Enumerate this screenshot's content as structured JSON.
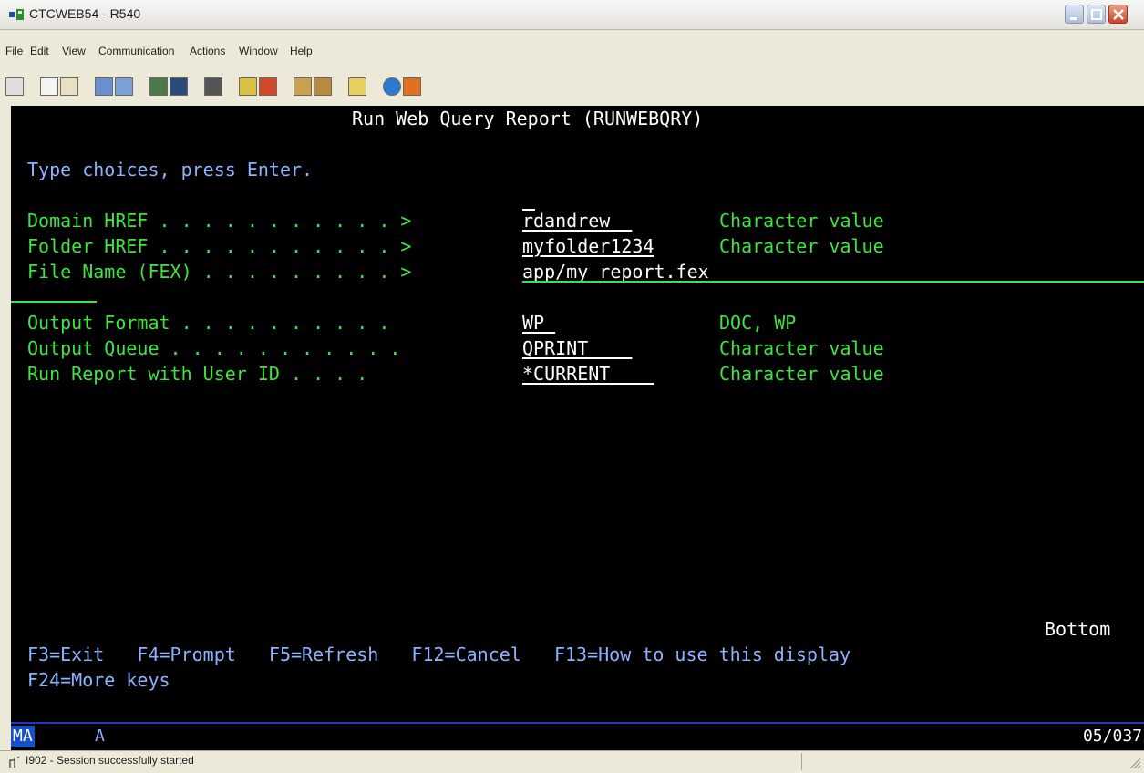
{
  "window": {
    "title": "CTCWEB54 - R540"
  },
  "menu": {
    "items": [
      "File",
      "Edit",
      "View",
      "Communication",
      "Actions",
      "Window",
      "Help"
    ]
  },
  "toolbar": {
    "icons": [
      "print-screen-icon",
      "copy-icon",
      "paste-icon",
      "send-icon",
      "receive-icon",
      "display-icon",
      "keypad-icon",
      "macro-icon",
      "record-icon",
      "play-icon",
      "transfer-icon",
      "receive-file-icon",
      "clipboard-icon",
      "globe-icon",
      "help-icon"
    ]
  },
  "screen": {
    "title": "Run Web Query Report (RUNWEBQRY)",
    "instruction": "Type choices, press Enter.",
    "params": [
      {
        "label": "Domain HREF . . . . . . . . . . . >",
        "value": "rdandrew  ",
        "hint": "Character value"
      },
      {
        "label": "Folder HREF . . . . . . . . . . . >",
        "value": "myfolder1234",
        "hint": "Character value"
      },
      {
        "label": "File Name (FEX) . . . . . . . . . >",
        "value": "app/my report.fex",
        "hint": ""
      },
      {
        "label": "Output Format . . . . . . . . . .  ",
        "value": "WP ",
        "hint": "DOC, WP"
      },
      {
        "label": "Output Queue . . . . . . . . . . . ",
        "value": "QPRINT    ",
        "hint": "Character value"
      },
      {
        "label": "Run Report with User ID . . . .    ",
        "value": "*CURRENT    ",
        "hint": "Character value"
      }
    ],
    "more_indicator": "Bottom",
    "fkeys_line1": "F3=Exit   F4=Prompt   F5=Refresh   F12=Cancel   F13=How to use this display",
    "fkeys_line2": "F24=More keys"
  },
  "oia": {
    "mode": "MA",
    "indicator": "A",
    "cursor_pos": "05/037"
  },
  "status": {
    "message": "I902 - Session successfully started"
  },
  "colors": {
    "field_green": "#3fe43f",
    "text_blue": "#8cb3ff",
    "background": "#000000",
    "mode_blue": "#1550c7"
  }
}
